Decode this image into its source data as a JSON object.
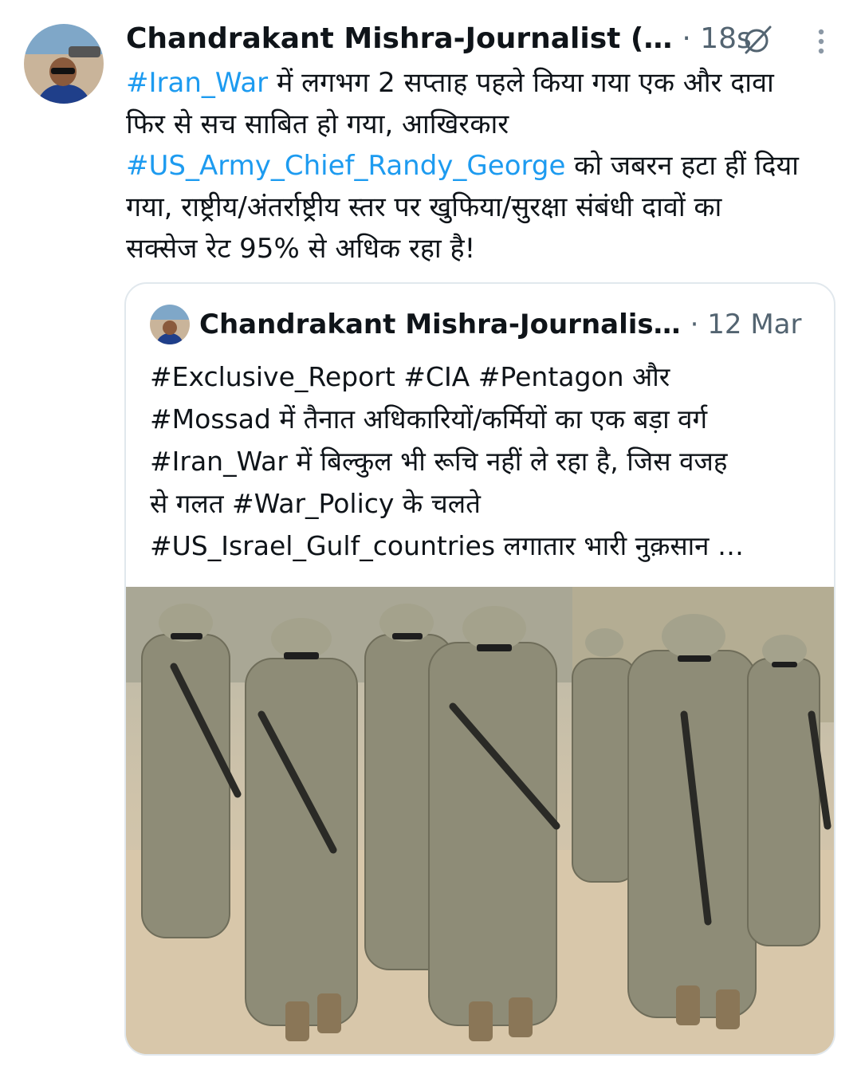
{
  "tweet": {
    "author_name": "Chandrakant Mishra-Journalist (…",
    "timestamp": "· 18s",
    "text_parts": [
      {
        "text": "#Iran_War",
        "tag": true
      },
      {
        "text": " में लगभग 2 सप्ताह पहले किया गया एक और दावा\nफिर से सच साबित हो गया, आखिरकार\n",
        "tag": false
      },
      {
        "text": "#US_Army_Chief_Randy_George",
        "tag": true
      },
      {
        "text": " को जबरन हटा हीं दिया\nगया, राष्ट्रीय/अंतर्राष्ट्रीय स्तर पर खुफिया/सुरक्षा संबंधी दावों का\nसक्सेज रेट 95% से अधिक रहा है!",
        "tag": false
      }
    ]
  },
  "quoted": {
    "author_name": "Chandrakant Mishra-Journalis…",
    "timestamp": "· 12 Mar",
    "text": "#Exclusive_Report #CIA #Pentagon और\n#Mossad में तैनात अधिकारियों/कर्मियों का एक बड़ा वर्ग\n#Iran_War में बिल्कुल भी रूचि नहीं ले रहा है, जिस वजह\nसे गलत #War_Policy के चलते\n#US_Israel_Gulf_countries लगातार भारी नुक़सान …"
  },
  "icons": {
    "grok": "grok-icon",
    "more": "more-vertical-icon"
  },
  "colors": {
    "link": "#1d9bf0",
    "secondary_text": "#536471",
    "border": "#e1e8ed",
    "camo": "#8d8c78",
    "sand": "#d9c6a8"
  }
}
